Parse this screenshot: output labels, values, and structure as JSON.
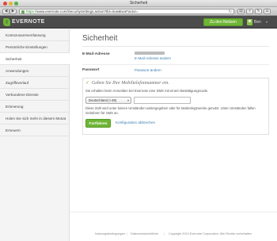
{
  "window": {
    "title": "Sicherheit"
  },
  "browser": {
    "url_scheme": "https://",
    "url_host": "www.evernote.com",
    "url_path": "/SecuritySettings.action?tbl=true&twoFactor=",
    "back_glyph": "◀",
    "forward_glyph": "▶",
    "reload_glyph": "↻",
    "toolbar_icons": [
      "book-icon",
      "plus-icon",
      "wrench-icon",
      "bookmark-icon"
    ],
    "toolbar_glyphs": [
      "▤",
      "+",
      "✎",
      "☰"
    ]
  },
  "header": {
    "brand": "EVERNOTE",
    "notes_button": "Zu den Notizen",
    "user_name": "Ben",
    "user_caret": "▾",
    "accent": "#6fb536",
    "bar_color": "#4b4b4b"
  },
  "sidebar": {
    "items": [
      {
        "label": "Kontozusammenfassung",
        "active": false
      },
      {
        "label": "Persönliche Einstellungen",
        "active": false
      },
      {
        "label": "Sicherheit",
        "active": true
      },
      {
        "label": "Anwendungen",
        "active": false
      },
      {
        "label": "Zugriffsverlauf",
        "active": false
      },
      {
        "label": "Verbundene Dienste",
        "active": false
      },
      {
        "label": "Erinnerung",
        "active": false
      },
      {
        "label": "Holen Sie sich mehr in diesem Monat",
        "active": false
      },
      {
        "label": "Erneuern",
        "active": false
      }
    ]
  },
  "main": {
    "title": "Sicherheit",
    "email": {
      "label": "E-Mail-Adresse",
      "change_link": "E-Mail-Adresse ändern"
    },
    "password": {
      "label": "Passwort",
      "change_link": "Passwort ändern"
    },
    "mobile": {
      "check_glyph": "✓",
      "heading": "Geben Sie Ihre Mobiltelefonnummer ein.",
      "description": "Sie erhalten beim Anmelden bei Evernote eine SMS mit einem Bestätigungscode.",
      "country_select_value": "Deutschland (+49)",
      "select_caret": "▾",
      "disclaimer": "Diese Zahl wird unter keinen Umständen weitergegeben oder für Marketingzwecke genutzt. Unter Umständen fallen Gebühren für SMS an.",
      "continue_button": "Fortfahren",
      "cancel_link": "Konfiguration abbrechen"
    }
  },
  "footer": {
    "links": [
      "Nutzungsbedingungen",
      "Datenschutzrichtlinie"
    ],
    "separator": "|",
    "copyright": "Copyright 2013 Evernote Corporation. Alle Rechte vorbehalten"
  }
}
